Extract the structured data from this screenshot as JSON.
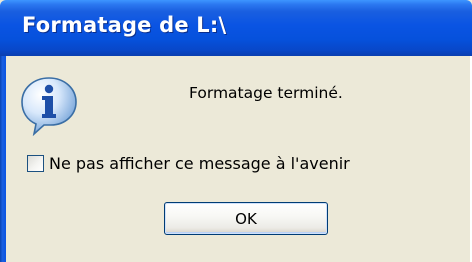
{
  "window": {
    "title": "Formatage de L:\\"
  },
  "dialog": {
    "icon": "info-icon",
    "message": "Formatage terminé.",
    "checkbox": {
      "label": "Ne pas afficher ce message à l'avenir",
      "checked": false
    },
    "ok_label": "OK"
  },
  "colors": {
    "titlebar": "#0a54e3",
    "dialog_bg": "#ece9d8",
    "button_border": "#003c74"
  }
}
